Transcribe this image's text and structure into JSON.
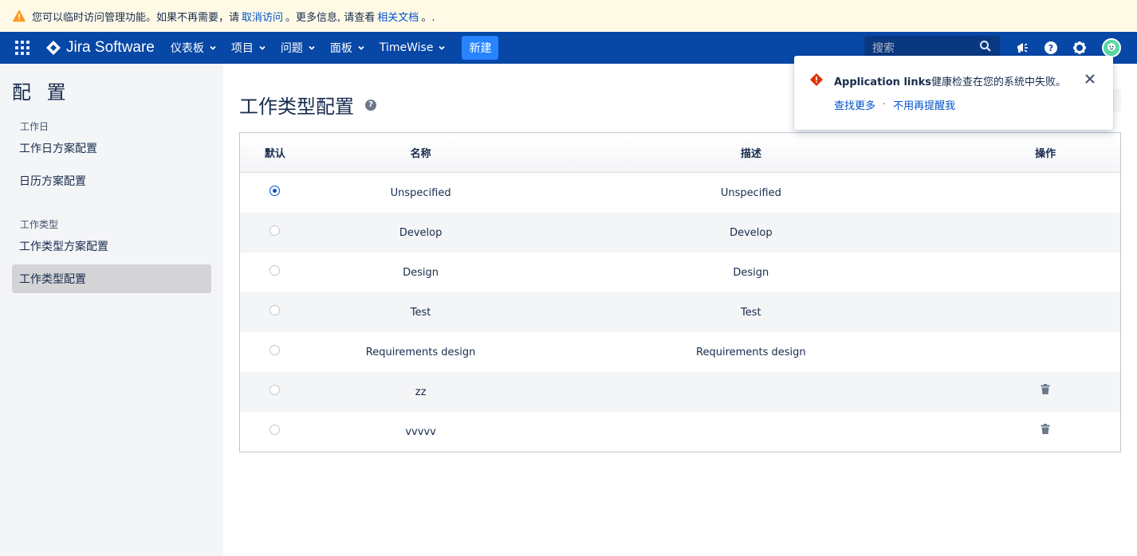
{
  "banner": {
    "text_before": "您可以临时访问管理功能。如果不再需要，请",
    "link_revoke": "取消访问",
    "text_middle": "。更多信息, 请查看",
    "link_docs": "相关文档",
    "text_after": "。."
  },
  "topnav": {
    "logo": "Jira Software",
    "items": [
      {
        "label": "仪表板"
      },
      {
        "label": "项目"
      },
      {
        "label": "问题"
      },
      {
        "label": "面板"
      },
      {
        "label": "TimeWise"
      }
    ],
    "create_label": "新建",
    "search_placeholder": "搜索"
  },
  "sidebar": {
    "title": "配 置",
    "groups": [
      {
        "heading": "工作日",
        "links": [
          "工作日方案配置",
          "日历方案配置"
        ]
      },
      {
        "heading": "工作类型",
        "links": [
          "工作类型方案配置",
          "工作类型配置"
        ]
      }
    ],
    "active": "工作类型配置"
  },
  "main": {
    "title": "工作类型配置",
    "help_glyph": "?",
    "columns": [
      "默认",
      "名称",
      "描述",
      "操作"
    ],
    "rows": [
      {
        "default": true,
        "name": "Unspecified",
        "description": "Unspecified",
        "deletable": false
      },
      {
        "default": false,
        "name": "Develop",
        "description": "Develop",
        "deletable": false
      },
      {
        "default": false,
        "name": "Design",
        "description": "Design",
        "deletable": false
      },
      {
        "default": false,
        "name": "Test",
        "description": "Test",
        "deletable": false
      },
      {
        "default": false,
        "name": "Requirements design",
        "description": "Requirements design",
        "deletable": false
      },
      {
        "default": false,
        "name": "zz",
        "description": "",
        "deletable": true
      },
      {
        "default": false,
        "name": "vvvvv",
        "description": "",
        "deletable": true
      }
    ]
  },
  "flag": {
    "title_bold": "Application links",
    "title_rest": "健康检查在您的系统中失败。",
    "action_learn": "查找更多",
    "separator": "·",
    "action_dismiss": "不用再提醒我"
  },
  "colors": {
    "nav_bg": "#0747a6",
    "create_btn": "#2684ff",
    "link": "#0052cc",
    "banner_bg": "#fffae6",
    "error": "#de350b"
  }
}
